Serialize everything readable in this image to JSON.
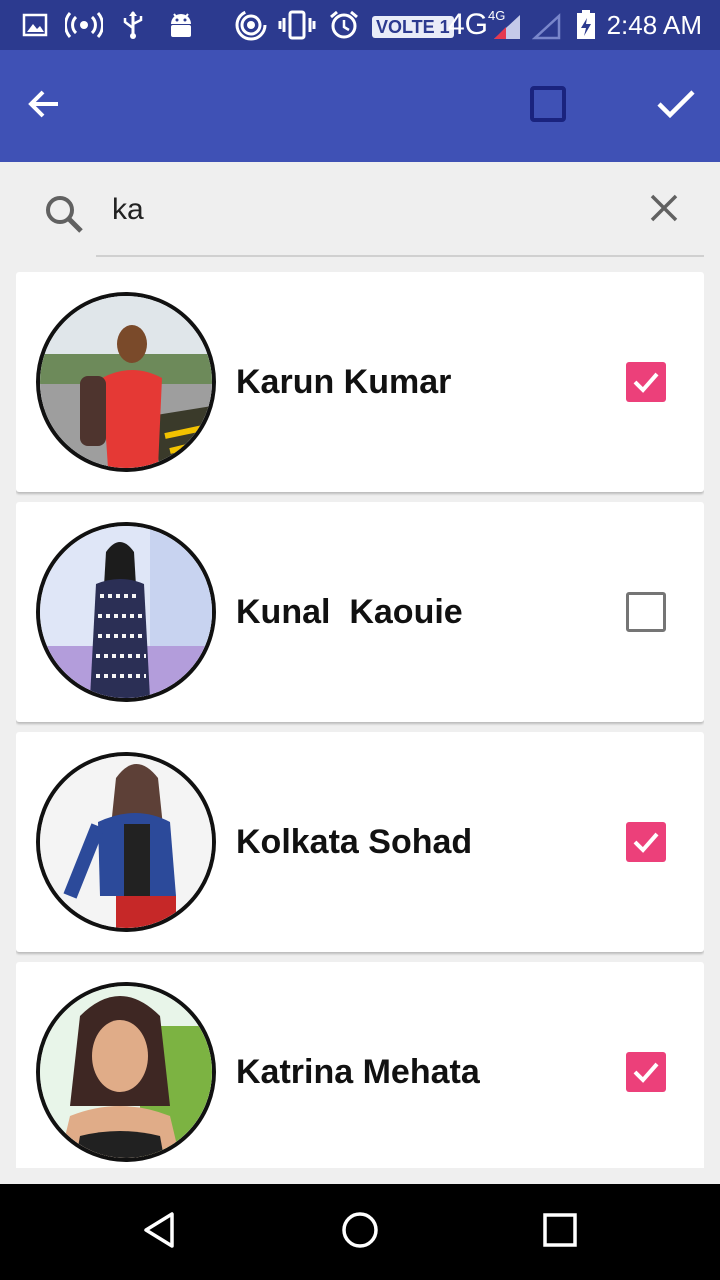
{
  "status_bar": {
    "time": "2:48 AM",
    "volte": "VOLTE 1",
    "network": "4G",
    "network_small": "4G",
    "icons": [
      "image-icon",
      "hotspot-icon",
      "usb-icon",
      "android-debug-icon",
      "wifi-tethering-icon",
      "vibrate-icon",
      "alarm-icon",
      "signal-icon",
      "signal-empty-icon",
      "battery-charging-icon"
    ]
  },
  "app_bar": {
    "back_icon": "arrow-back-icon",
    "select_all_icon": "checkbox-outline-icon",
    "confirm_icon": "check-icon"
  },
  "search": {
    "value": "ka",
    "placeholder": "",
    "search_icon": "search-icon",
    "clear_icon": "close-icon"
  },
  "contacts": [
    {
      "name": "Karun Kumar",
      "checked": true
    },
    {
      "name": "Kunal  Kaouie",
      "checked": false
    },
    {
      "name": "Kolkata Sohad",
      "checked": true
    },
    {
      "name": "Katrina Mehata",
      "checked": true
    }
  ],
  "nav_bar": {
    "icons": [
      "back-triangle-icon",
      "home-circle-icon",
      "recents-square-icon"
    ]
  },
  "colors": {
    "status_bar": "#2c3a8f",
    "app_bar": "#3f51b5",
    "checkbox_checked": "#ec407a",
    "background": "#efefef"
  }
}
